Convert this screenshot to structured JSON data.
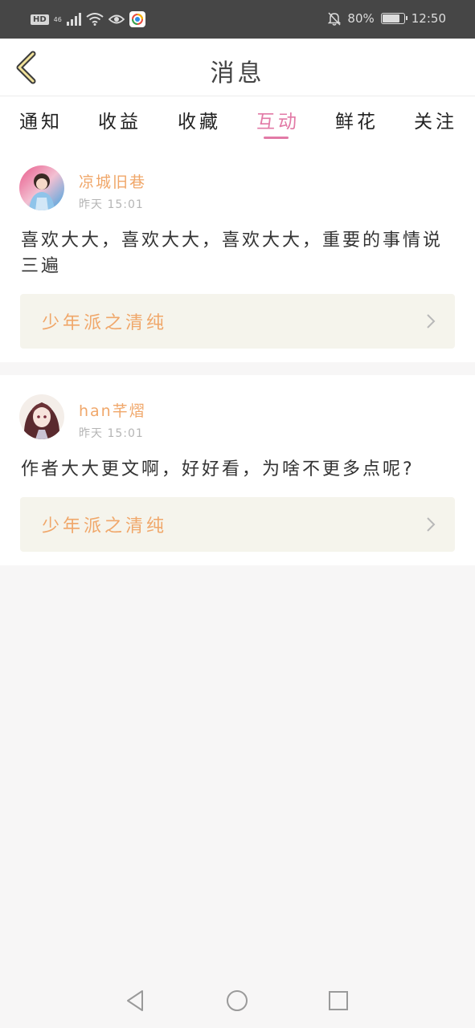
{
  "status_bar": {
    "hd": "HD",
    "network": "46",
    "battery_percent": "80%",
    "battery_level": 0.8,
    "time": "12:50"
  },
  "header": {
    "title": "消息"
  },
  "tabs": [
    {
      "label": "通知",
      "active": false
    },
    {
      "label": "收益",
      "active": false
    },
    {
      "label": "收藏",
      "active": false
    },
    {
      "label": "互动",
      "active": true
    },
    {
      "label": "鲜花",
      "active": false
    },
    {
      "label": "关注",
      "active": false
    }
  ],
  "messages": [
    {
      "username": "凉城旧巷",
      "time": "昨天 15:01",
      "comment": "喜欢大大，喜欢大大，喜欢大大，重要的事情说三遍",
      "book": "少年派之清纯"
    },
    {
      "username": "han芊熠",
      "time": "昨天 15:01",
      "comment": "作者大大更文啊，好好看，为啥不更多点呢?",
      "book": "少年派之清纯"
    }
  ],
  "colors": {
    "accent": "#e27aa6",
    "username": "#f0a76a",
    "book_bg": "#f5f4ec"
  }
}
